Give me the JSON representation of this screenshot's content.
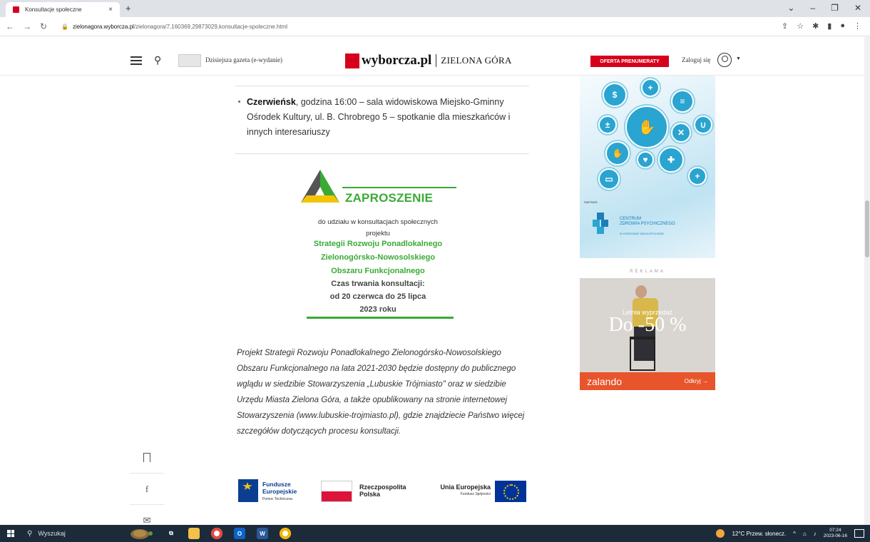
{
  "browser": {
    "tab_title": "Konsultacje społeczne",
    "tab_close": "×",
    "new_tab": "+",
    "url_host": "zielonagora.wyborcza.pl",
    "url_path": "/zielonagora/7,160369,29873029,konsultacje-spoleczne.html"
  },
  "header": {
    "egazeta_label": "Dzisiejsza gazeta (e-wydanie)",
    "logo_main": "wyborcza.pl",
    "logo_city": "ZIELONA GÓRA",
    "oferta_label": "OFERTA PRENUMERATY",
    "login_label": "Zaloguj się"
  },
  "article": {
    "bullet_bold": "Czerwieńsk",
    "bullet_rest": ", godzina 16:00 – sala widowiskowa Miejsko-Gminny Ośrodek Kultury, ul. B. Chrobrego 5 – spotkanie dla mieszkańców i innych interesariuszy",
    "invitation": {
      "title": "ZAPROSZENIE",
      "line1": "do udziału w konsultacjach społecznych",
      "line2": "projektu",
      "green1": "Strategii Rozwoju Ponadlokalnego",
      "green2": "Zielonogórsko-Nowosolskiego",
      "green3": "Obszaru Funkcjonalnego",
      "dark1": "Czas trwania konsultacji:",
      "dark2": "od 20 czerwca do 25 lipca",
      "dark3": "2023 roku"
    },
    "paragraph": "Projekt Strategii Rozwoju Ponadlokalnego Zielonogórsko-Nowosolskiego Obszaru Funkcjonalnego na lata 2021-2030 będzie dostępny do publicznego wglądu w siedzibie Stowarzyszenia „Lubuskie Trójmiasto\" oraz w siedzibie Urzędu Miasta Zielona Góra, a także opublikowany na stronie internetowej Stowarzyszenia (www.lubuskie-trojmiasto.pl), gdzie znajdziecie Państwo więcej szczegółów dotyczących procesu konsultacji.",
    "logos": {
      "fe_line1": "Fundusze",
      "fe_line2": "Europejskie",
      "fe_sub": "Pomoc Techniczna",
      "pl_line1": "Rzeczpospolita",
      "pl_line2": "Polska",
      "ue_line1": "Unia Europejska",
      "ue_sub": "Fundusz Spójności"
    }
  },
  "ads": {
    "partner_label": "PARTNER",
    "czp_line1": "CENTRUM",
    "czp_line2": "ZDROWIA PSYCHICZNEGO",
    "czp_sub": "W GORZOWIE WIELKOPOLSKIM",
    "reklama_label": "REKLAMA",
    "zalando_small": "Letnia wyprzedaż",
    "zalando_big": "Do -50 %",
    "zalando_brand": "zalando",
    "zalando_cta": "Odkryj →"
  },
  "taskbar": {
    "search_placeholder": "Wyszukaj",
    "weather": "12°C Przew. słonecz.",
    "time": "07:24",
    "date": "2023-06-16"
  }
}
